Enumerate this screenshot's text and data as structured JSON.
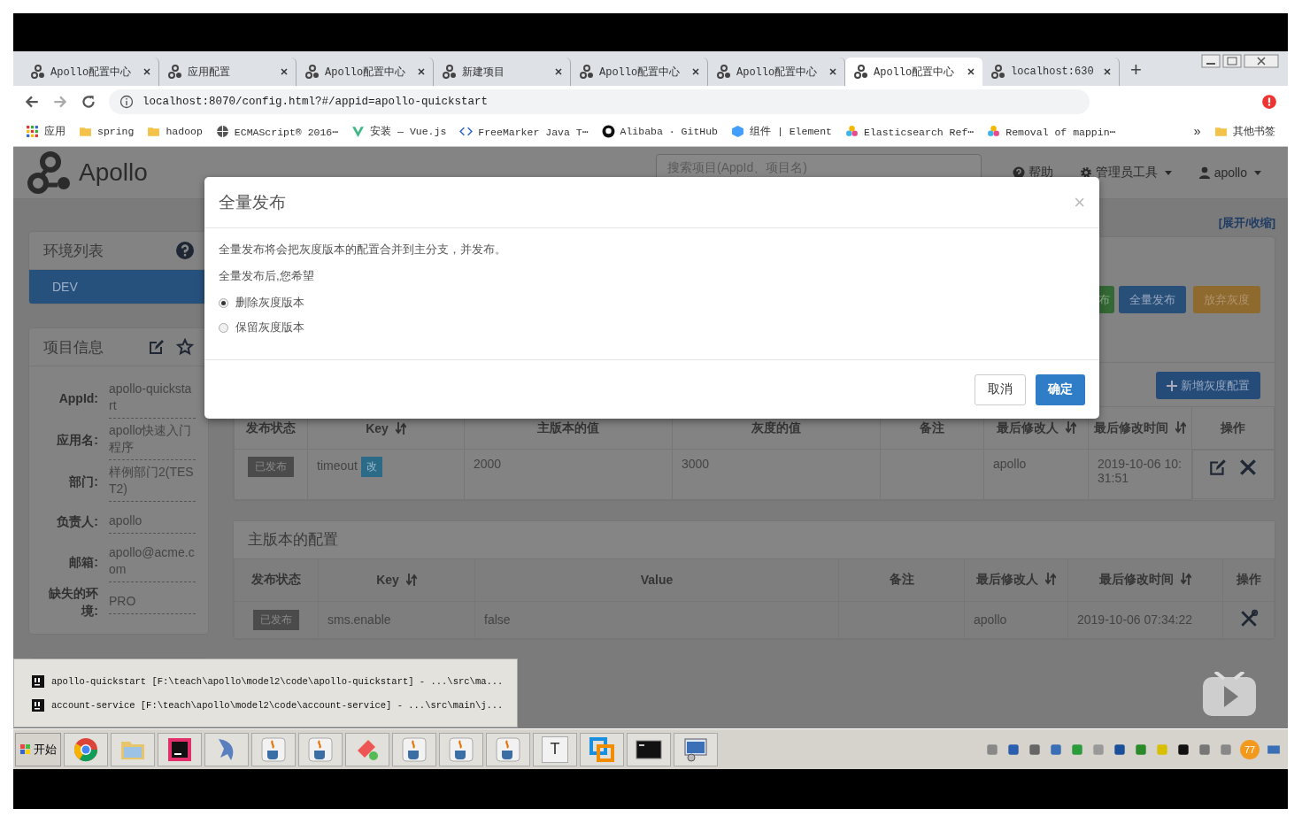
{
  "browser": {
    "tabs": [
      {
        "title": "Apollo配置中心",
        "selected": false
      },
      {
        "title": "应用配置",
        "selected": false
      },
      {
        "title": "Apollo配置中心",
        "selected": false
      },
      {
        "title": "新建项目",
        "selected": false
      },
      {
        "title": "Apollo配置中心",
        "selected": false
      },
      {
        "title": "Apollo配置中心",
        "selected": false
      },
      {
        "title": "Apollo配置中心",
        "selected": true
      },
      {
        "title": "localhost:630",
        "selected": false
      }
    ],
    "new_tab": "+",
    "address": "localhost:8070/config.html?#/appid=apollo-quickstart",
    "bookmarks": [
      {
        "label": "应用",
        "kind": "grid"
      },
      {
        "label": "spring",
        "kind": "folder"
      },
      {
        "label": "hadoop",
        "kind": "folder"
      },
      {
        "label": "ECMAScript® 2016⋯",
        "kind": "globe"
      },
      {
        "label": "安装 — Vue.js",
        "kind": "chevron"
      },
      {
        "label": "FreeMarker Java T⋯",
        "kind": "code"
      },
      {
        "label": "Alibaba · GitHub",
        "kind": "circle"
      },
      {
        "label": "组件 | Element",
        "kind": "hexagon"
      },
      {
        "label": "Elasticsearch Ref⋯",
        "kind": "flower"
      },
      {
        "label": "Removal of mappin⋯",
        "kind": "flower"
      }
    ],
    "more": "»",
    "other_bookmarks": "其他书签"
  },
  "header": {
    "brand": "Apollo",
    "search": {
      "placeholder": "搜索项目(AppId、项目名)"
    },
    "nav": [
      {
        "label": "帮助",
        "kind": "help"
      },
      {
        "label": "管理员工具",
        "kind": "admin"
      },
      {
        "label": "apollo",
        "kind": "user"
      }
    ]
  },
  "sidebar": {
    "env_title": "环境列表",
    "envs": [
      {
        "label": "DEV",
        "selected": true
      }
    ],
    "info_title": "项目信息",
    "info": [
      {
        "label": "AppId:",
        "value": "apollo-quickstart"
      },
      {
        "label": "应用名:",
        "value": "apollo快速入门程序"
      },
      {
        "label": "部门:",
        "value": "样例部门2(TEST2)"
      },
      {
        "label": "负责人:",
        "value": "apollo"
      },
      {
        "label": "邮箱:",
        "value": "apollo@acme.com"
      },
      {
        "label": "缺失的环境:",
        "value": "PRO"
      }
    ]
  },
  "gray": {
    "toggle": "[展开/收缩]",
    "actions": [
      {
        "label": "布",
        "kind": "release"
      },
      {
        "label": "全量发布",
        "kind": "merge"
      },
      {
        "label": "放弃灰度",
        "kind": "abandon"
      }
    ],
    "add_button": "新增灰度配置",
    "columns": [
      {
        "label": "发布状态",
        "sortable": false
      },
      {
        "label": "Key",
        "sortable": true
      },
      {
        "label": "主版本的值",
        "sortable": false
      },
      {
        "label": "灰度的值",
        "sortable": false
      },
      {
        "label": "备注",
        "sortable": false
      },
      {
        "label": "最后修改人",
        "sortable": true
      },
      {
        "label": "最后修改时间",
        "sortable": true
      },
      {
        "label": "操作",
        "sortable": false
      }
    ],
    "rows": [
      {
        "status": "已发布",
        "key": "timeout",
        "change": "改",
        "master_value": "2000",
        "gray_value": "3000",
        "modifier": "apollo",
        "modified": "2019-10-06 10:31:51"
      }
    ]
  },
  "master": {
    "title": "主版本的配置",
    "columns": [
      {
        "label": "发布状态",
        "sortable": false
      },
      {
        "label": "Key",
        "sortable": true
      },
      {
        "label": "Value",
        "sortable": false
      },
      {
        "label": "备注",
        "sortable": false
      },
      {
        "label": "最后修改人",
        "sortable": true
      },
      {
        "label": "最后修改时间",
        "sortable": true
      },
      {
        "label": "操作",
        "sortable": false
      }
    ],
    "rows": [
      {
        "status": "已发布",
        "key": "sms.enable",
        "value": "false",
        "modifier": "apollo",
        "modified": "2019-10-06 07:34:22"
      }
    ]
  },
  "modal": {
    "title": "全量发布",
    "close": "×",
    "message": "全量发布将会把灰度版本的配置合并到主分支，并发布。",
    "prompt": "全量发布后,您希望",
    "options": [
      {
        "label": "删除灰度版本",
        "selected": true
      },
      {
        "label": "保留灰度版本",
        "selected": false
      }
    ],
    "cancel": "取消",
    "confirm": "确定"
  },
  "jump_list": [
    {
      "title": "apollo-quickstart [F:\\teach\\apollo\\model2\\code\\apollo-quickstart] - ...\\src\\ma..."
    },
    {
      "title": "account-service [F:\\teach\\apollo\\model2\\code\\account-service] - ...\\src\\main\\j..."
    }
  ],
  "taskbar": {
    "start": "开始",
    "text_app": "T",
    "tray_badge": "77"
  }
}
